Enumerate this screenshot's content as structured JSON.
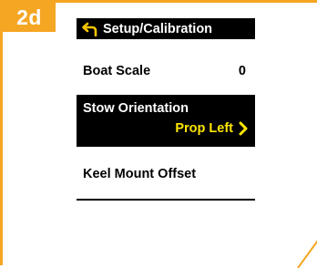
{
  "step": "2d",
  "header": {
    "title": "Setup/Calibration",
    "back_icon": "back-arrow-icon"
  },
  "menu": {
    "boat_scale": {
      "label": "Boat Scale",
      "value": "0"
    },
    "stow_orientation": {
      "label": "Stow Orientation",
      "value": "Prop Left",
      "icon": "chevron-right-icon"
    },
    "keel_mount_offset": {
      "label": "Keel Mount Offset"
    }
  },
  "colors": {
    "accent": "#f5a623",
    "selected_bg": "#000000",
    "selected_value": "#ffe600"
  }
}
